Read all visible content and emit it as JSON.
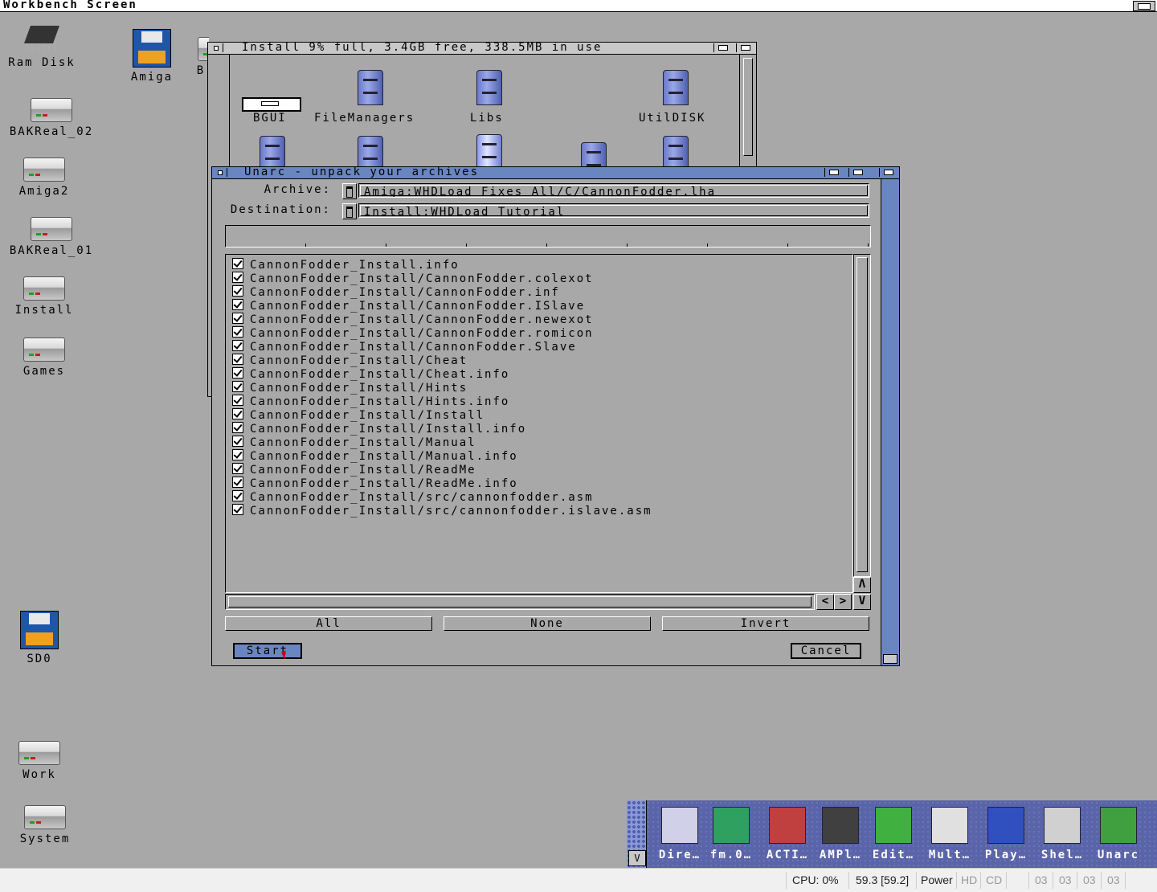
{
  "screen": {
    "title": "Workbench Screen"
  },
  "desktop_icons": [
    {
      "name": "ram-disk",
      "label": "Ram Disk",
      "type": "chip"
    },
    {
      "name": "amiga",
      "label": "Amiga",
      "type": "floppy"
    },
    {
      "name": "bakreal-02",
      "label": "BAKReal_02",
      "type": "hd"
    },
    {
      "name": "amiga2",
      "label": "Amiga2",
      "type": "hd"
    },
    {
      "name": "bakreal-01",
      "label": "BAKReal_01",
      "type": "hd"
    },
    {
      "name": "install",
      "label": "Install",
      "type": "hd"
    },
    {
      "name": "games",
      "label": "Games",
      "type": "hd"
    },
    {
      "name": "sd0",
      "label": "SD0",
      "type": "floppy"
    },
    {
      "name": "work",
      "label": "Work",
      "type": "hd"
    },
    {
      "name": "system",
      "label": "System",
      "type": "hd"
    },
    {
      "name": "partial",
      "label": "B",
      "type": "hd"
    }
  ],
  "install_window": {
    "title": "Install  9% full, 3.4GB free, 338.5MB  in  use",
    "items": [
      "BGUI",
      "FileManagers",
      "Libs",
      "UtilDISK"
    ]
  },
  "unarc": {
    "title": "Unarc  -  unpack  your  archives",
    "archive_label": "Archive:",
    "archive_value": "Amiga:WHDLoad_Fixes_All/C/CannonFodder.lha",
    "destination_label": "Destination:",
    "destination_value": "Install:WHDLoad_Tutorial",
    "files": [
      "CannonFodder_Install.info",
      "CannonFodder_Install/CannonFodder.colexot",
      "CannonFodder_Install/CannonFodder.inf",
      "CannonFodder_Install/CannonFodder.ISlave",
      "CannonFodder_Install/CannonFodder.newexot",
      "CannonFodder_Install/CannonFodder.romicon",
      "CannonFodder_Install/CannonFodder.Slave",
      "CannonFodder_Install/Cheat",
      "CannonFodder_Install/Cheat.info",
      "CannonFodder_Install/Hints",
      "CannonFodder_Install/Hints.info",
      "CannonFodder_Install/Install",
      "CannonFodder_Install/Install.info",
      "CannonFodder_Install/Manual",
      "CannonFodder_Install/Manual.info",
      "CannonFodder_Install/ReadMe",
      "CannonFodder_Install/ReadMe.info",
      "CannonFodder_Install/src/cannonfodder.asm",
      "CannonFodder_Install/src/cannonfodder.islave.asm"
    ],
    "buttons": {
      "all": "All",
      "none": "None",
      "invert": "Invert",
      "start": "Start",
      "cancel": "Cancel"
    },
    "scroll_up": "Λ",
    "scroll_down": "V",
    "scroll_left": "<",
    "scroll_right": ">"
  },
  "dock": {
    "down_arrow": "V",
    "items": [
      {
        "name": "dire",
        "label": "Dire…",
        "color": "#d0d0e8"
      },
      {
        "name": "fm",
        "label": "fm.0…",
        "color": "#30a060"
      },
      {
        "name": "acti",
        "label": "ACTI…",
        "color": "#c04040"
      },
      {
        "name": "ampl",
        "label": "AMPl…",
        "color": "#404040"
      },
      {
        "name": "edit",
        "label": "Edit…",
        "color": "#40b040"
      },
      {
        "name": "mult",
        "label": "Mult…",
        "color": "#e0e0e0"
      },
      {
        "name": "play",
        "label": "Play…",
        "color": "#3050c0"
      },
      {
        "name": "shel",
        "label": "Shel…",
        "color": "#d0d0d0"
      },
      {
        "name": "unarc",
        "label": "Unarc",
        "color": "#40a040"
      }
    ]
  },
  "status_bar": {
    "cpu": "CPU: 0%",
    "fps": "59.3 [59.2]",
    "power": "Power",
    "hd": "HD",
    "cd": "CD",
    "drives": [
      "03",
      "03",
      "03",
      "03"
    ]
  }
}
